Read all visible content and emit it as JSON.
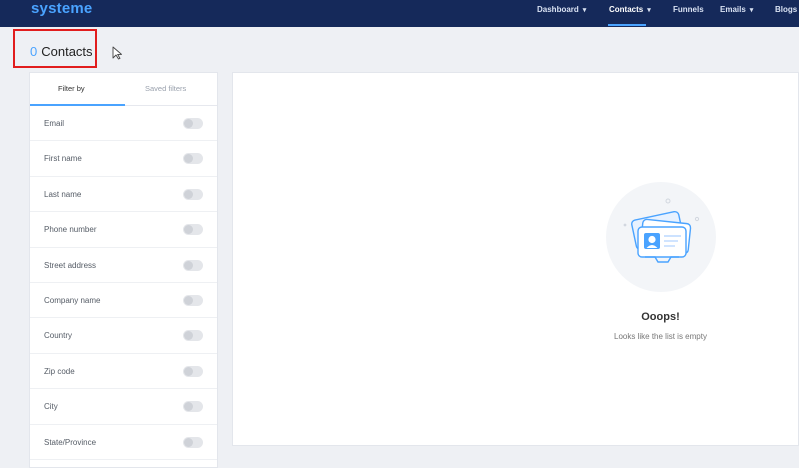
{
  "header": {
    "logo": "systeme",
    "nav": [
      {
        "label": "Dashboard",
        "has_dropdown": true
      },
      {
        "label": "Contacts",
        "has_dropdown": true,
        "active": true
      },
      {
        "label": "Funnels",
        "has_dropdown": false
      },
      {
        "label": "Emails",
        "has_dropdown": true
      },
      {
        "label": "Blogs",
        "has_dropdown": false
      }
    ],
    "colors": {
      "bar": "#15295a",
      "accent": "#4aa3ff"
    }
  },
  "page": {
    "count": "0",
    "title": "Contacts"
  },
  "sidebar": {
    "tabs": [
      "Filter by",
      "Saved filters"
    ],
    "filters": [
      "Email",
      "First name",
      "Last name",
      "Phone number",
      "Street address",
      "Company name",
      "Country",
      "Zip code",
      "City",
      "State/Province"
    ]
  },
  "empty_state": {
    "title": "Ooops!",
    "subtitle": "Looks like the list is empty",
    "illustration": "contact-cards-icon"
  },
  "icons": {
    "dropdown": "chevron-down-icon",
    "cursor": "mouse-pointer-icon"
  }
}
